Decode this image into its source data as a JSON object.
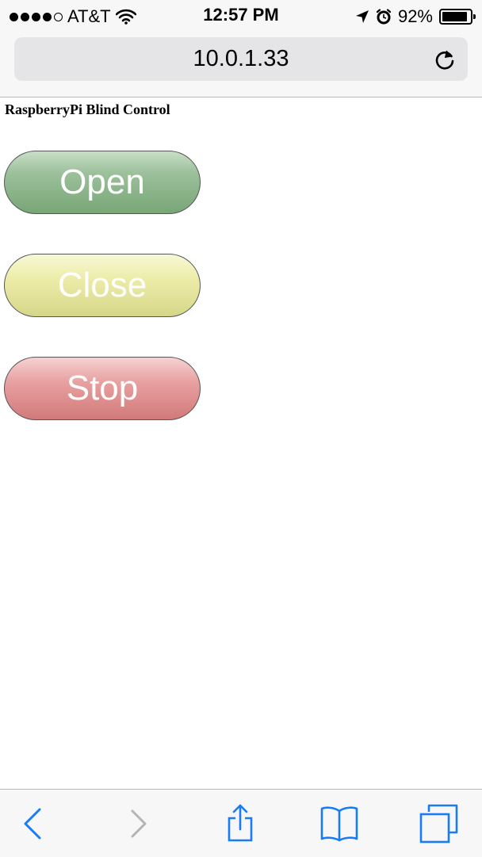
{
  "status_bar": {
    "carrier": "AT&T",
    "time": "12:57 PM",
    "battery": "92%",
    "battery_level": 0.92
  },
  "address_bar": {
    "url": "10.0.1.33"
  },
  "page": {
    "title": "RaspberryPi Blind Control",
    "buttons": [
      {
        "label": "Open",
        "color": "#8fb78e"
      },
      {
        "label": "Close",
        "color": "#e3e39c"
      },
      {
        "label": "Stop",
        "color": "#e08f8f"
      }
    ]
  },
  "toolbar": {
    "accent_color": "#1a7cf5",
    "disabled_color": "#b4b4b4",
    "icons": [
      "back-icon",
      "forward-icon",
      "share-icon",
      "bookmarks-icon",
      "tabs-icon"
    ]
  }
}
